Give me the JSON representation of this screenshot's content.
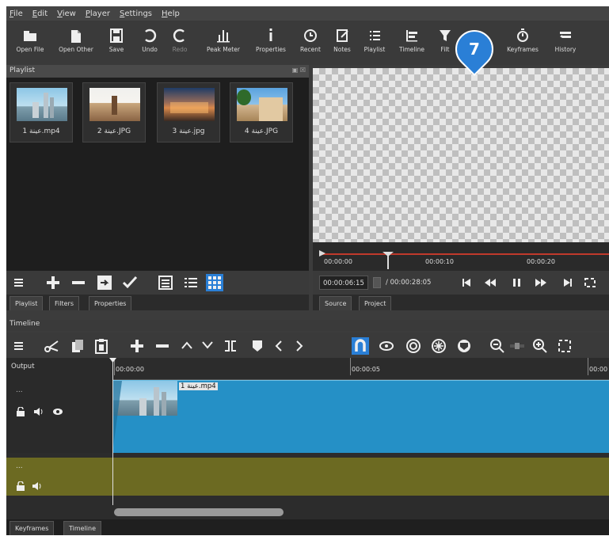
{
  "menu": [
    "File",
    "Edit",
    "View",
    "Player",
    "Settings",
    "Help"
  ],
  "toolbar": {
    "open_file": "Open File",
    "open_other": "Open Other",
    "save": "Save",
    "undo": "Undo",
    "redo": "Redo",
    "peak_meter": "Peak Meter",
    "properties": "Properties",
    "recent": "Recent",
    "notes": "Notes",
    "playlist": "Playlist",
    "timeline": "Timeline",
    "filters": "Filt",
    "keyframes": "Keyframes",
    "history": "History"
  },
  "callout": "7",
  "playlist": {
    "title": "Playlist",
    "clips": [
      {
        "name": "1 عينة.mp4"
      },
      {
        "name": "2 عينة.JPG"
      },
      {
        "name": "3 عينة.jpg"
      },
      {
        "name": "4 عينة.JPG"
      }
    ],
    "tabs": [
      "Playlist",
      "Filters",
      "Properties"
    ]
  },
  "viewer": {
    "ruler_ticks": [
      "00:00:00",
      "00:00:10",
      "00:00:20"
    ],
    "position": "00:00:06:15",
    "duration": "/ 00:00:28:05",
    "tabs": [
      "Source",
      "Project"
    ]
  },
  "timeline": {
    "title": "Timeline",
    "output_label": "Output",
    "ruler_ticks": [
      "00:00:00",
      "00:00:05",
      "00:00"
    ],
    "clip_label": "عينة 1.mp4",
    "track_dots": "...",
    "bottom_tabs": [
      "Keyframes",
      "Timeline"
    ]
  },
  "colors": {
    "video_track": "#2590c6",
    "audio_track": "#6c6a22",
    "callout": "#2a7fd6",
    "accent": "#2a7fd6"
  }
}
